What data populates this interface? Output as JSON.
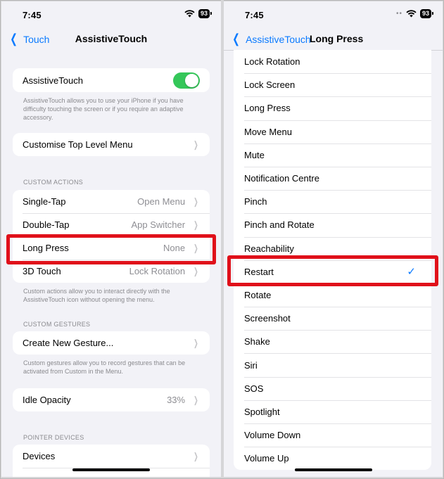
{
  "left": {
    "status_bar": {
      "time": "7:45",
      "battery": "93"
    },
    "nav": {
      "back_label": "Touch",
      "title": "AssistiveTouch"
    },
    "assistive_touch": {
      "label": "AssistiveTouch",
      "toggle_on": true,
      "footnote": "AssistiveTouch allows you to use your iPhone if you have difficulty touching the screen or if you require an adaptive accessory."
    },
    "customise_label": "Customise Top Level Menu",
    "custom_actions": {
      "header": "CUSTOM ACTIONS",
      "rows": [
        {
          "label": "Single-Tap",
          "value": "Open Menu"
        },
        {
          "label": "Double-Tap",
          "value": "App Switcher"
        },
        {
          "label": "Long Press",
          "value": "None"
        },
        {
          "label": "3D Touch",
          "value": "Lock Rotation"
        }
      ],
      "footnote": "Custom actions allow you to interact directly with the AssistiveTouch icon without opening the menu."
    },
    "custom_gestures": {
      "header": "CUSTOM GESTURES",
      "create_label": "Create New Gesture...",
      "footnote": "Custom gestures allow you to record gestures that can be activated from Custom in the Menu."
    },
    "idle_opacity": {
      "label": "Idle Opacity",
      "value": "33%"
    },
    "pointer_devices": {
      "header": "POINTER DEVICES",
      "devices_label": "Devices"
    }
  },
  "right": {
    "status_bar": {
      "time": "7:45",
      "battery": "93"
    },
    "nav": {
      "back_label": "AssistiveTouch",
      "title": "Long Press"
    },
    "options": [
      "Lock Rotation",
      "Lock Screen",
      "Long Press",
      "Move Menu",
      "Mute",
      "Notification Centre",
      "Pinch",
      "Pinch and Rotate",
      "Reachability",
      "Restart",
      "Rotate",
      "Screenshot",
      "Shake",
      "Siri",
      "SOS",
      "Spotlight",
      "Volume Down",
      "Volume Up"
    ],
    "selected": "Restart"
  },
  "colors": {
    "accent": "#0a7aff",
    "toggle_on": "#34c759",
    "highlight": "#e0101a"
  },
  "icons": {
    "wifi": "wifi-icon",
    "back": "chevron-left-icon",
    "disclosure": "chevron-right-icon",
    "check": "checkmark-icon"
  }
}
